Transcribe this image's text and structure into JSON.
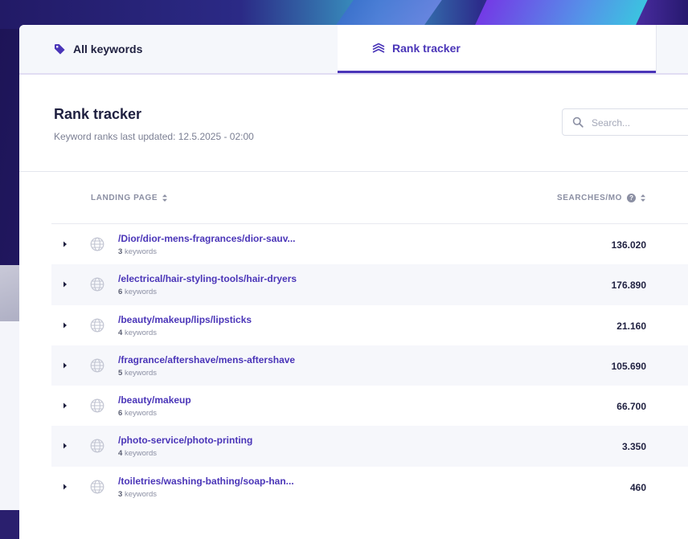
{
  "tabs": {
    "all_keywords": "All keywords",
    "rank_tracker": "Rank tracker"
  },
  "header": {
    "title": "Rank tracker",
    "subtitle": "Keyword ranks last updated: 12.5.2025 - 02:00"
  },
  "search": {
    "placeholder": "Search..."
  },
  "table": {
    "columns": {
      "landing_page": "LANDING PAGE",
      "searches": "SEARCHES/MO"
    },
    "keywords_suffix": "keywords",
    "rows": [
      {
        "page": "/Dior/dior-mens-fragrances/dior-sauv...",
        "count": "3",
        "searches": "136.020"
      },
      {
        "page": "/electrical/hair-styling-tools/hair-dryers",
        "count": "6",
        "searches": "176.890"
      },
      {
        "page": "/beauty/makeup/lips/lipsticks",
        "count": "4",
        "searches": "21.160"
      },
      {
        "page": "/fragrance/aftershave/mens-aftershave",
        "count": "5",
        "searches": "105.690"
      },
      {
        "page": "/beauty/makeup",
        "count": "6",
        "searches": "66.700"
      },
      {
        "page": "/photo-service/photo-printing",
        "count": "4",
        "searches": "3.350"
      },
      {
        "page": "/toiletries/washing-bathing/soap-han...",
        "count": "3",
        "searches": "460"
      }
    ]
  },
  "colors": {
    "accent": "#4a35b8",
    "text": "#1f2040",
    "muted": "#8b8fa3"
  },
  "icons": {
    "tab_all": "tag-icon",
    "tab_rank": "layers-icon",
    "search": "search-icon",
    "row": "globe-icon",
    "expand": "caret-right-icon"
  }
}
